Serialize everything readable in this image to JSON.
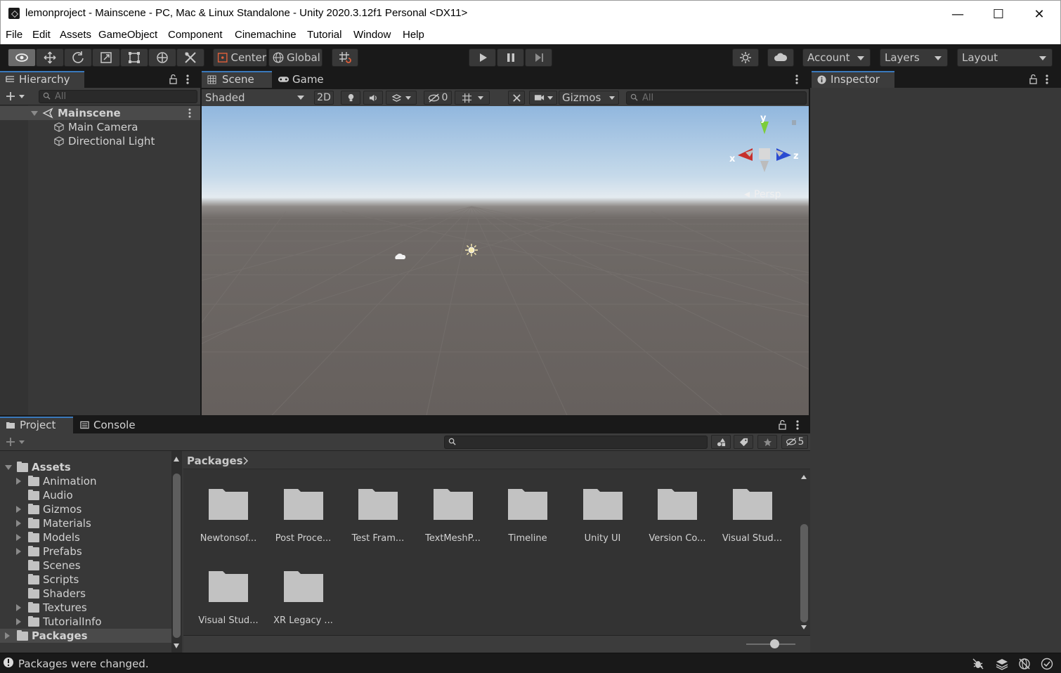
{
  "window": {
    "title": "lemonproject - Mainscene - PC, Mac & Linux Standalone - Unity 2020.3.12f1 Personal <DX11>",
    "minimize_glyph": "—",
    "maximize_glyph": "☐",
    "close_glyph": "✕"
  },
  "menu": [
    "File",
    "Edit",
    "Assets",
    "GameObject",
    "Component",
    "Cinemachine",
    "Tutorial",
    "Window",
    "Help"
  ],
  "toolbar": {
    "pivot_label": "Center",
    "space_label": "Global",
    "account_label": "Account",
    "layers_label": "Layers",
    "layout_label": "Layout"
  },
  "hierarchy": {
    "tab_label": "Hierarchy",
    "search_placeholder": "All",
    "scene_name": "Mainscene",
    "objects": [
      "Main Camera",
      "Directional Light"
    ]
  },
  "scene": {
    "tabs": [
      "Scene",
      "Game"
    ],
    "shading_mode": "Shaded",
    "mode_2d_label": "2D",
    "hidden_count": "0",
    "gizmos_label": "Gizmos",
    "search_placeholder": "All",
    "axis_x": "x",
    "axis_y": "y",
    "axis_z": "z",
    "projection_label": "Persp"
  },
  "inspector": {
    "tab_label": "Inspector"
  },
  "project": {
    "tabs": [
      "Project",
      "Console"
    ],
    "hidden_packages_count": "5",
    "breadcrumb": "Packages",
    "tree": [
      {
        "label": "Assets",
        "level": 0,
        "expanded": true,
        "bold": true
      },
      {
        "label": "Animation",
        "level": 1,
        "has_children": true
      },
      {
        "label": "Audio",
        "level": 1,
        "has_children": false
      },
      {
        "label": "Gizmos",
        "level": 1,
        "has_children": true
      },
      {
        "label": "Materials",
        "level": 1,
        "has_children": true
      },
      {
        "label": "Models",
        "level": 1,
        "has_children": true
      },
      {
        "label": "Prefabs",
        "level": 1,
        "has_children": true
      },
      {
        "label": "Scenes",
        "level": 1,
        "has_children": false
      },
      {
        "label": "Scripts",
        "level": 1,
        "has_children": false
      },
      {
        "label": "Shaders",
        "level": 1,
        "has_children": false
      },
      {
        "label": "Textures",
        "level": 1,
        "has_children": true
      },
      {
        "label": "TutorialInfo",
        "level": 1,
        "has_children": true
      },
      {
        "label": "Packages",
        "level": 0,
        "expanded": false,
        "bold": true,
        "selected": true
      }
    ],
    "packages": [
      "Newtonsof...",
      "Post Proce...",
      "Test Fram...",
      "TextMeshP...",
      "Timeline",
      "Unity UI",
      "Version Co...",
      "Visual Stud...",
      "Visual Stud...",
      "XR Legacy ..."
    ]
  },
  "status": {
    "message": "Packages were changed."
  },
  "colors": {
    "accent": "#3a79bb",
    "panel": "#383838",
    "toolbar": "#191919"
  }
}
